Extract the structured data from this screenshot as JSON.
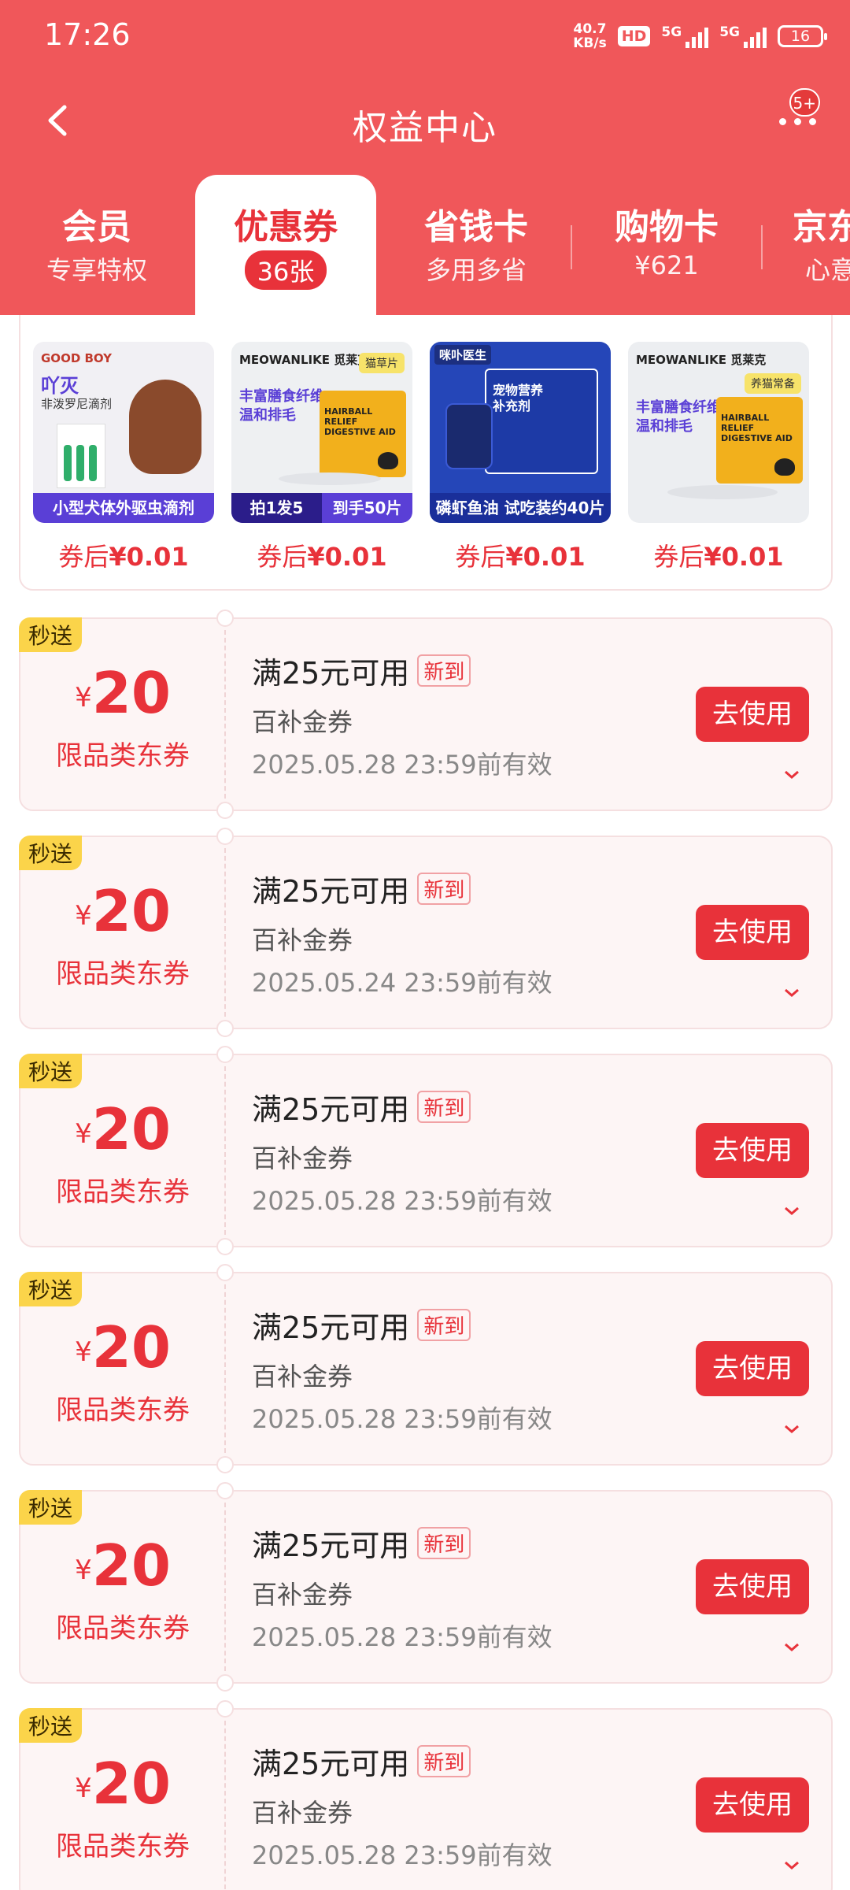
{
  "status_bar": {
    "time": "17:26",
    "net_speed_top": "40.7",
    "net_speed_bottom": "KB/s",
    "hd": "HD",
    "signal1": "5G",
    "signal2": "5G",
    "battery": "16"
  },
  "nav": {
    "title": "权益中心",
    "badge": "5+"
  },
  "tabs": [
    {
      "title": "会员",
      "sub": "专享特权"
    },
    {
      "title": "优惠券",
      "sub": "36张"
    },
    {
      "title": "省钱卡",
      "sub": "多用多省"
    },
    {
      "title": "购物卡",
      "sub": "¥621"
    },
    {
      "title": "京东",
      "sub": "心意"
    }
  ],
  "products": [
    {
      "price_prefix": "券后",
      "price": "¥0.01",
      "brand": "GOOD BOY",
      "title": "吖灭",
      "sub": "非泼罗尼滴剂",
      "band": "小型犬体外驱虫滴剂"
    },
    {
      "price_prefix": "券后",
      "price": "¥0.01",
      "brand": "MEOWANLIKE 觅莱克",
      "line1": "丰富膳食纤维",
      "line2": "温和排毛",
      "tag": "猫草片",
      "band_left": "拍1发5",
      "band_right": "到手50片",
      "box": "HAIRBALL RELIEF DIGESTIVE AID"
    },
    {
      "price_prefix": "券后",
      "price": "¥0.01",
      "brand": "咪卟医生",
      "line1": "宠物营养",
      "line2": "补充剂",
      "band": "磷虾鱼油 试吃装约40片"
    },
    {
      "price_prefix": "券后",
      "price": "¥0.01",
      "brand": "MEOWANLIKE 觅莱克",
      "line1": "丰富膳食纤维",
      "line2": "温和排毛",
      "tag": "养猫常备",
      "box": "HAIRBALL RELIEF DIGESTIVE AID"
    }
  ],
  "coupons": [
    {
      "tag": "秒送",
      "currency": "¥",
      "amount": "20",
      "type": "限品类东券",
      "condition": "满25元可用",
      "badge": "新到",
      "name": "百补金券",
      "valid": "2025.05.28 23:59前有效",
      "button": "去使用"
    },
    {
      "tag": "秒送",
      "currency": "¥",
      "amount": "20",
      "type": "限品类东券",
      "condition": "满25元可用",
      "badge": "新到",
      "name": "百补金券",
      "valid": "2025.05.24 23:59前有效",
      "button": "去使用"
    },
    {
      "tag": "秒送",
      "currency": "¥",
      "amount": "20",
      "type": "限品类东券",
      "condition": "满25元可用",
      "badge": "新到",
      "name": "百补金券",
      "valid": "2025.05.28 23:59前有效",
      "button": "去使用"
    },
    {
      "tag": "秒送",
      "currency": "¥",
      "amount": "20",
      "type": "限品类东券",
      "condition": "满25元可用",
      "badge": "新到",
      "name": "百补金券",
      "valid": "2025.05.28 23:59前有效",
      "button": "去使用"
    },
    {
      "tag": "秒送",
      "currency": "¥",
      "amount": "20",
      "type": "限品类东券",
      "condition": "满25元可用",
      "badge": "新到",
      "name": "百补金券",
      "valid": "2025.05.28 23:59前有效",
      "button": "去使用"
    },
    {
      "tag": "秒送",
      "currency": "¥",
      "amount": "20",
      "type": "限品类东券",
      "condition": "满25元可用",
      "badge": "新到",
      "name": "百补金券",
      "valid": "2025.05.28 23:59前有效",
      "button": "去使用"
    }
  ],
  "colors": {
    "brand_red": "#e8323a",
    "header_red": "#f0575a",
    "tag_yellow": "#fbd44a"
  }
}
